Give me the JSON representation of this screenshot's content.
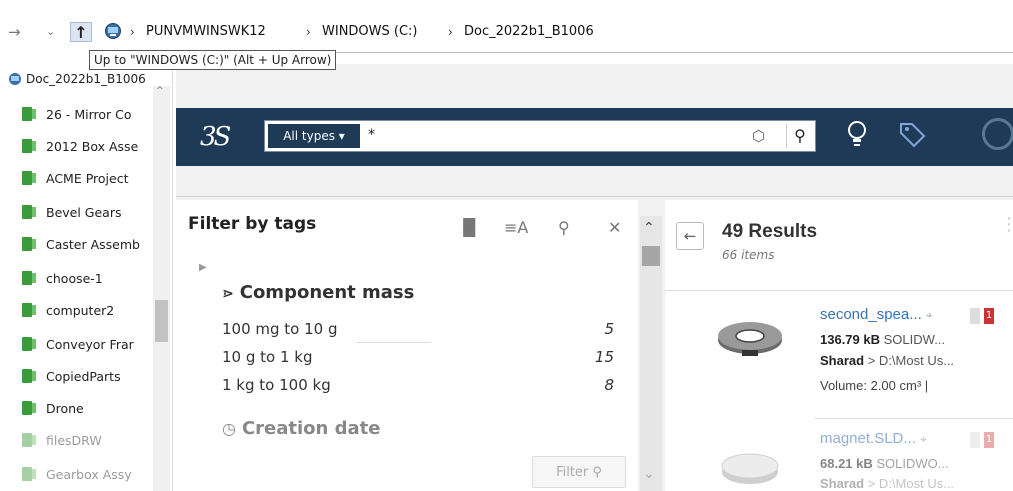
{
  "explorer": {
    "breadcrumbs": [
      "PUNVMWINSWK12",
      "WINDOWS (C:)",
      "Doc_2022b1_B1006"
    ],
    "tooltip": "Up to \"WINDOWS (C:)\" (Alt + Up Arrow)",
    "tree_root": "Doc_2022b1_B1006",
    "tree_items": [
      "26 - Mirror Co",
      "2012 Box Asse",
      "ACME Project",
      "Bevel Gears",
      "Caster Assemb",
      "choose-1",
      "computer2",
      "Conveyor Frar",
      "CopiedParts",
      "Drone",
      "filesDRW",
      "Gearbox Assy"
    ]
  },
  "search": {
    "types_label": "All types ▾",
    "query": "*"
  },
  "filter": {
    "title": "Filter by tags",
    "mass_header": "Component mass",
    "mass_rows": [
      {
        "label": "100 mg to 10 g",
        "count": "5"
      },
      {
        "label": "10 g to 1 kg",
        "count": "15"
      },
      {
        "label": "1 kg to 100 kg",
        "count": "8"
      }
    ],
    "date_header": "Creation date",
    "filter_button": "Filter"
  },
  "results": {
    "count": "49 Results",
    "items_label": "66 items",
    "items": [
      {
        "name": "second_spea...",
        "size": "136.79 kB",
        "type": "SOLIDW...",
        "owner": "Sharad",
        "path": "D:\\Most Us...",
        "volume": "Volume: 2.00 cm³ |",
        "badge": "1"
      },
      {
        "name": "magnet.SLD...",
        "size": "68.21 kB",
        "type": "SOLIDWO...",
        "owner": "Sharad",
        "path": "D:\\Most Us...",
        "badge": "1"
      }
    ]
  },
  "colors": {
    "topbar": "#1e3a57",
    "link": "#3874b8",
    "folder": "#3a9b3a"
  }
}
